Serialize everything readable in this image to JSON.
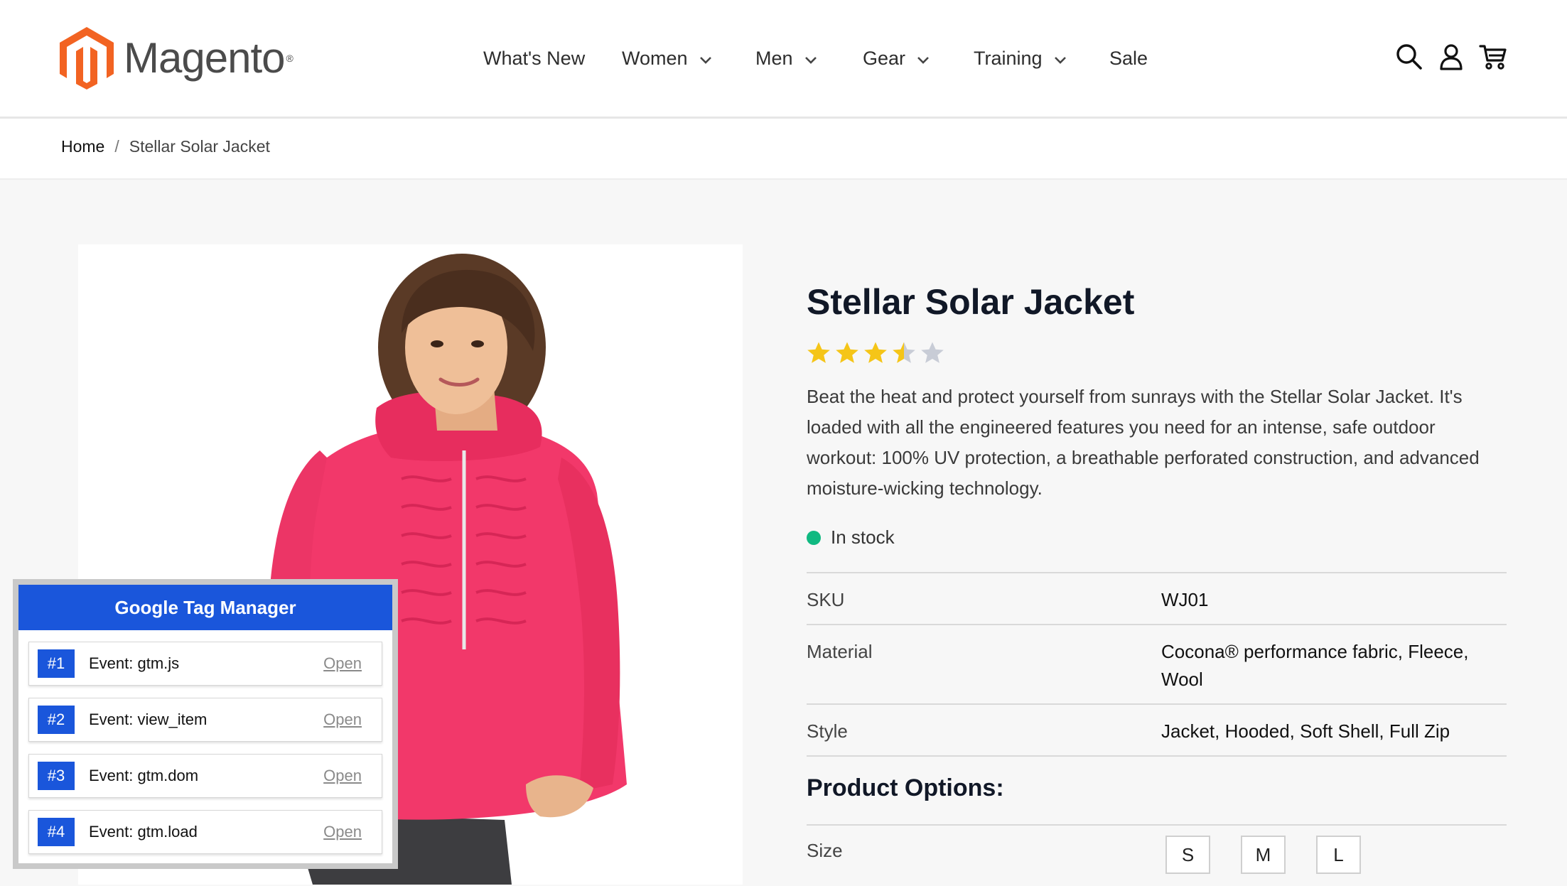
{
  "header": {
    "logo_text": "Magento",
    "logo_mark": "®",
    "nav": [
      {
        "label": "What's New",
        "has_dropdown": false
      },
      {
        "label": "Women",
        "has_dropdown": true
      },
      {
        "label": "Men",
        "has_dropdown": true
      },
      {
        "label": "Gear",
        "has_dropdown": true
      },
      {
        "label": "Training",
        "has_dropdown": true
      },
      {
        "label": "Sale",
        "has_dropdown": false
      }
    ],
    "icons": [
      "search-icon",
      "account-icon",
      "cart-icon"
    ]
  },
  "breadcrumb": {
    "home": "Home",
    "separator": "/",
    "current": "Stellar Solar Jacket"
  },
  "product": {
    "title": "Stellar Solar Jacket",
    "rating": 3.5,
    "rating_max": 5,
    "description": "Beat the heat and protect yourself from sunrays with the Stellar Solar Jacket. It's loaded with all the engineered features you need for an intense, safe outdoor workout: 100% UV protection, a breathable perforated construction, and advanced moisture-wicking technology.",
    "stock": "In stock",
    "specs": [
      {
        "label": "SKU",
        "value": "WJ01"
      },
      {
        "label": "Material",
        "value": "Cocona® performance fabric, Fleece, Wool"
      },
      {
        "label": "Style",
        "value": "Jacket, Hooded, Soft Shell, Full Zip"
      }
    ],
    "options_title": "Product Options:",
    "size_label": "Size",
    "sizes": [
      "S",
      "M",
      "L"
    ]
  },
  "gtm": {
    "title": "Google Tag Manager",
    "events": [
      {
        "num": "#1",
        "event": "Event: gtm.js",
        "action": "Open"
      },
      {
        "num": "#2",
        "event": "Event: view_item",
        "action": "Open"
      },
      {
        "num": "#3",
        "event": "Event: gtm.dom",
        "action": "Open"
      },
      {
        "num": "#4",
        "event": "Event: gtm.load",
        "action": "Open"
      }
    ]
  },
  "colors": {
    "brand_orange": "#f26322",
    "gtm_blue": "#1a56db",
    "star_gold": "#f5c518",
    "star_gray": "#c8ccd6",
    "stock_green": "#10b981",
    "jacket_pink": "#f2386a"
  }
}
